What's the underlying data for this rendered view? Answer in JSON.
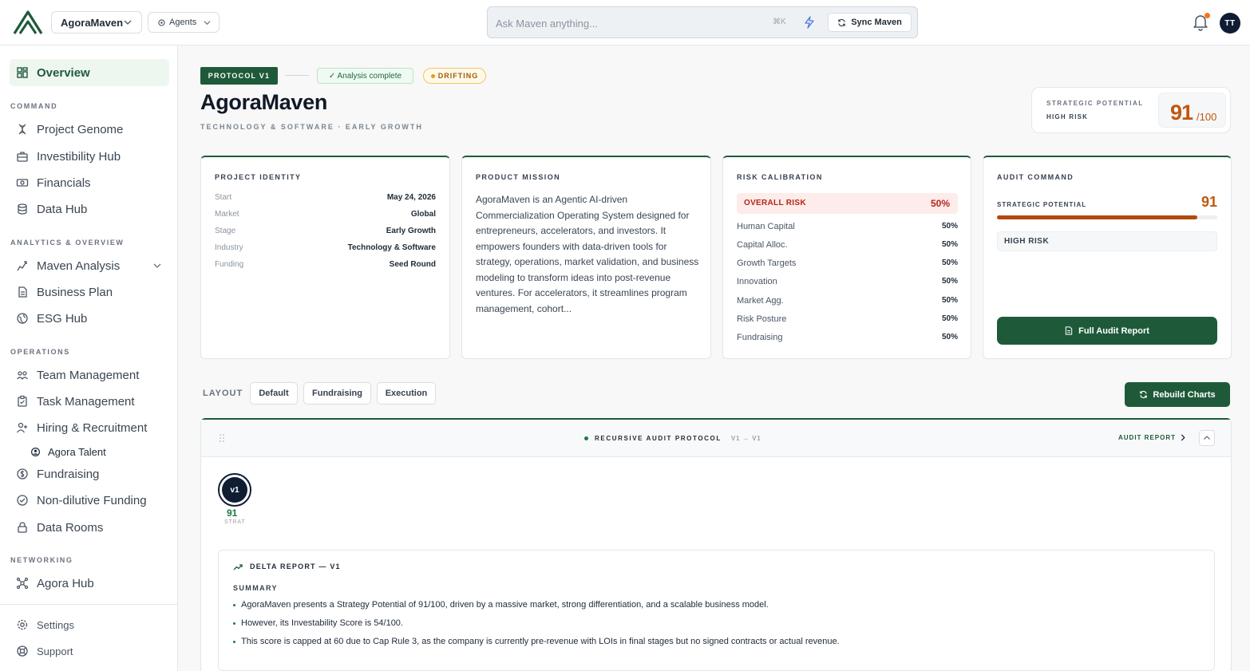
{
  "header": {
    "org_name": "AgoraMaven",
    "agents_label": "Agents",
    "search_placeholder": "Ask Maven anything...",
    "search_shortcut": "⌘K",
    "sync_label": "Sync Maven",
    "avatar_initials": "TT"
  },
  "sidebar": {
    "overview": "Overview",
    "sections": {
      "command": "COMMAND",
      "analytics": "ANALYTICS & OVERVIEW",
      "operations": "OPERATIONS",
      "networking": "NETWORKING"
    },
    "items": {
      "project_genome": "Project Genome",
      "investibility_hub": "Investibility Hub",
      "financials": "Financials",
      "data_hub": "Data Hub",
      "maven_analysis": "Maven Analysis",
      "business_plan": "Business Plan",
      "esg_hub": "ESG Hub",
      "team_management": "Team Management",
      "task_management": "Task Management",
      "hiring": "Hiring & Recruitment",
      "agora_talent": "Agora Talent",
      "fundraising": "Fundraising",
      "non_dilutive": "Non-dilutive Funding",
      "data_rooms": "Data Rooms",
      "agora_hub": "Agora Hub",
      "settings": "Settings",
      "support": "Support"
    }
  },
  "main": {
    "protocol_tag": "PROTOCOL V1",
    "analysis_badge": "✓ Analysis complete",
    "drift_badge": "DRIFTING",
    "title": "AgoraMaven",
    "subtitle": "TECHNOLOGY & SOFTWARE · EARLY GROWTH",
    "score_card": {
      "label": "STRATEGIC POTENTIAL",
      "risk": "HIGH RISK",
      "score": "91",
      "denominator": "/100"
    }
  },
  "cards": {
    "identity": {
      "title": "PROJECT IDENTITY",
      "rows": [
        {
          "k": "Start",
          "v": "May 24, 2026"
        },
        {
          "k": "Market",
          "v": "Global"
        },
        {
          "k": "Stage",
          "v": "Early Growth"
        },
        {
          "k": "Industry",
          "v": "Technology & Software"
        },
        {
          "k": "Funding",
          "v": "Seed Round"
        }
      ]
    },
    "mission": {
      "title": "PRODUCT MISSION",
      "text": "AgoraMaven is an Agentic AI-driven Commercialization Operating System designed for entrepreneurs, accelerators, and investors. It empowers founders with data-driven tools for strategy, operations, market validation, and business modeling to transform ideas into post-revenue ventures. For accelerators, it streamlines program management, cohort..."
    },
    "risk": {
      "title": "RISK CALIBRATION",
      "overall_label": "OVERALL RISK",
      "overall_value": "50%",
      "rows": [
        {
          "k": "Human Capital",
          "v": "50%"
        },
        {
          "k": "Capital Alloc.",
          "v": "50%"
        },
        {
          "k": "Growth Targets",
          "v": "50%"
        },
        {
          "k": "Innovation",
          "v": "50%"
        },
        {
          "k": "Market Agg.",
          "v": "50%"
        },
        {
          "k": "Risk Posture",
          "v": "50%"
        },
        {
          "k": "Fundraising",
          "v": "50%"
        }
      ]
    },
    "audit": {
      "title": "AUDIT COMMAND",
      "sp_label": "STRATEGIC POTENTIAL",
      "sp_value": "91",
      "sp_fraction": 0.91,
      "risk_label": "HIGH RISK",
      "button": "Full Audit Report"
    }
  },
  "layout": {
    "label": "LAYOUT",
    "options": [
      "Default",
      "Fundraising",
      "Execution"
    ],
    "rebuild": "Rebuild Charts"
  },
  "panel": {
    "title": "RECURSIVE AUDIT PROTOCOL",
    "version_range": "V1 → V1",
    "audit_link": "AUDIT REPORT",
    "node_label": "v1",
    "node_score": "91",
    "node_caption": "STRAT",
    "delta_title": "DELTA REPORT — V1",
    "summary_label": "SUMMARY",
    "bullets": [
      "AgoraMaven presents a Strategy Potential of 91/100, driven by a massive market, strong differentiation, and a scalable business model.",
      "However, its Investability Score is 54/100.",
      "This score is capped at 60 due to Cap Rule 3, as the company is currently pre-revenue with LOIs in final stages but no signed contracts or actual revenue."
    ]
  }
}
